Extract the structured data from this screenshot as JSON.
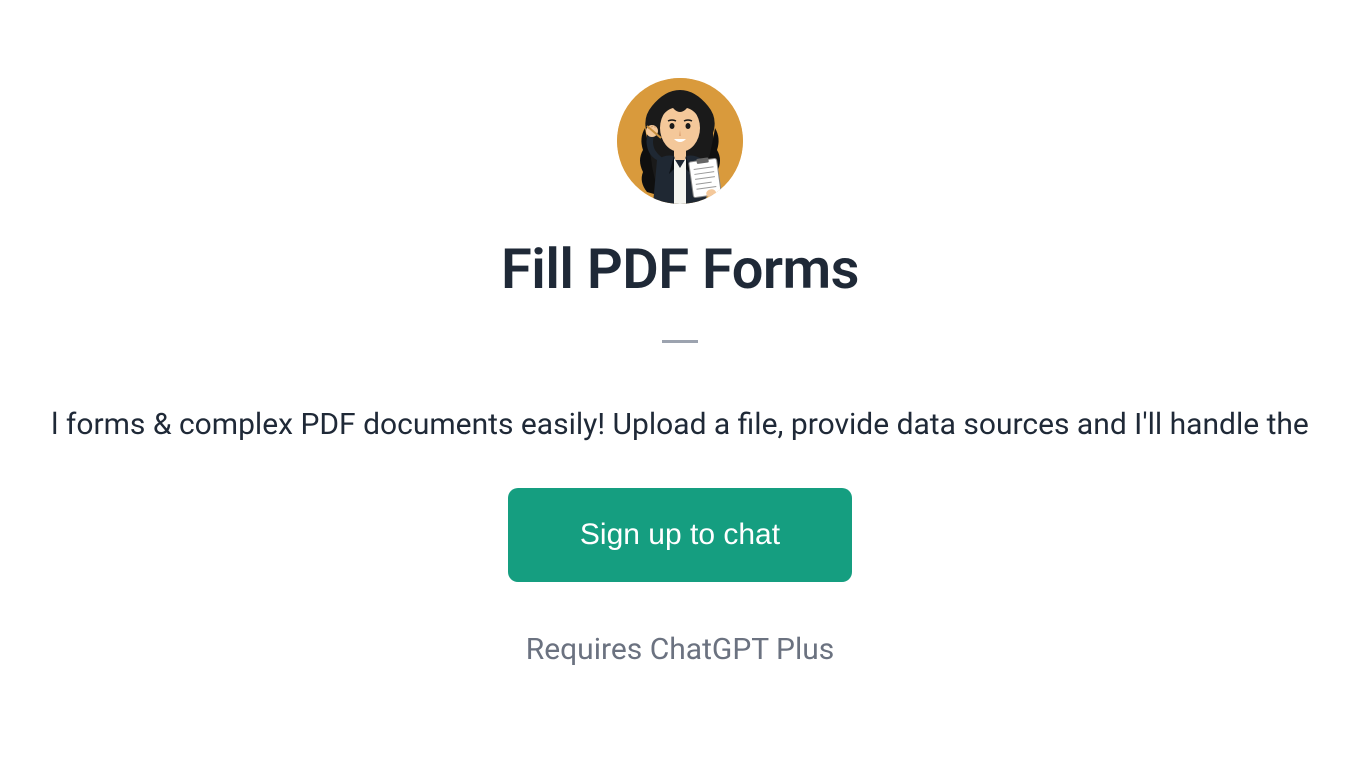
{
  "header": {
    "title": "Fill PDF Forms"
  },
  "description": "l forms & complex PDF documents easily! Upload a file, provide data sources and I'll handle the",
  "cta": {
    "signup_label": "Sign up to chat"
  },
  "footer": {
    "requirement": "Requires ChatGPT Plus"
  },
  "avatar": {
    "alt": "woman-with-document-avatar"
  }
}
